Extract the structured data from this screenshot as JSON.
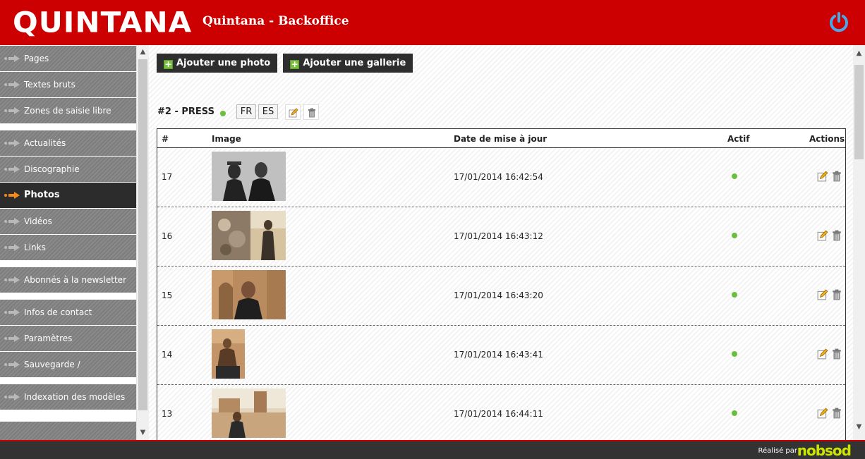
{
  "header": {
    "logo_text": "QUINTANA",
    "title": "Quintana - Backoffice"
  },
  "sidebar": {
    "groups": [
      {
        "items": [
          {
            "label": "Pages"
          },
          {
            "label": "Textes bruts"
          },
          {
            "label": "Zones de saisie libre"
          }
        ]
      },
      {
        "items": [
          {
            "label": "Actualités"
          },
          {
            "label": "Discographie"
          },
          {
            "label": "Photos",
            "active": true
          },
          {
            "label": "Vidéos"
          },
          {
            "label": "Links"
          }
        ]
      },
      {
        "items": [
          {
            "label": "Abonnés à la newsletter"
          }
        ]
      },
      {
        "items": [
          {
            "label": "Infos de contact"
          },
          {
            "label": "Paramètres"
          },
          {
            "label": "Sauvegarde / Restauration"
          }
        ]
      },
      {
        "items": [
          {
            "label": "Indexation des modèles"
          }
        ]
      }
    ]
  },
  "toolbar": {
    "add_photo": "Ajouter une photo",
    "add_gallery": "Ajouter une gallerie"
  },
  "gallery": {
    "title": "#2 - PRESS",
    "lang_fr": "FR",
    "lang_es": "ES"
  },
  "table": {
    "headers": {
      "num": "#",
      "image": "Image",
      "date": "Date de mise à jour",
      "active": "Actif",
      "actions": "Actions"
    },
    "rows": [
      {
        "num": "17",
        "date": "17/01/2014 16:42:54"
      },
      {
        "num": "16",
        "date": "17/01/2014 16:43:12"
      },
      {
        "num": "15",
        "date": "17/01/2014 16:43:20"
      },
      {
        "num": "14",
        "date": "17/01/2014 16:43:41"
      },
      {
        "num": "13",
        "date": "17/01/2014 16:44:11"
      }
    ]
  },
  "footer": {
    "realise_par": "Réalisé par",
    "brand": "nobsod"
  },
  "colors": {
    "header_red": "#cc0000",
    "active_green": "#6cbf3c",
    "arrow_orange": "#f08a1c",
    "brand_lime": "#cde600"
  }
}
